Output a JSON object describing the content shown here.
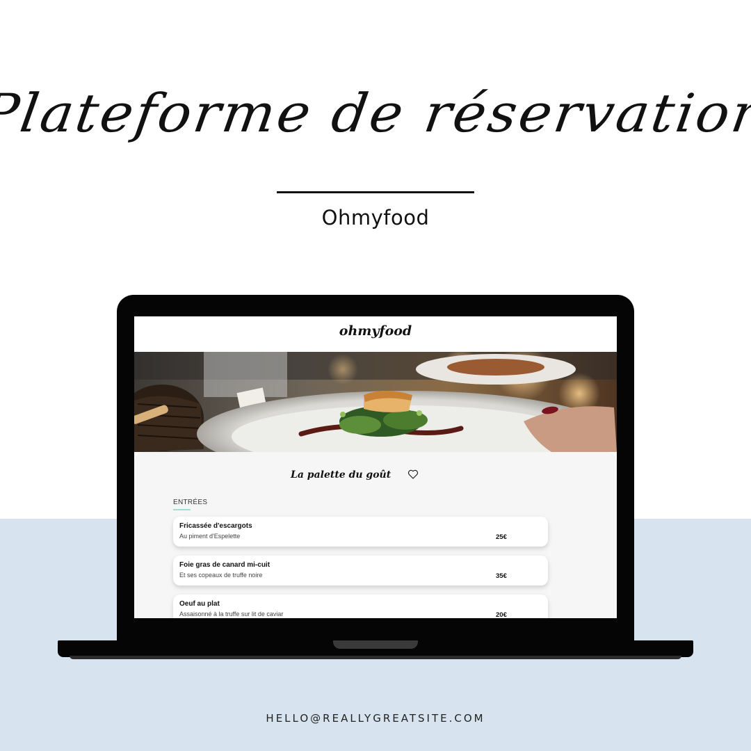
{
  "poster": {
    "title": "Plateforme de réservation",
    "subtitle": "Ohmyfood",
    "contact_email": "HELLO@REALLYGREATSITE.COM"
  },
  "website": {
    "logo": "ohmyfood",
    "hero_image": "restaurant-plated-dish-photo",
    "restaurant": {
      "name": "La palette du goût",
      "favorite_icon": "heart-icon"
    },
    "menu": {
      "section_label": "ENTRÉES",
      "items": [
        {
          "name": "Fricassée d'escargots",
          "description": "Au piment d'Espelette",
          "price": "25€"
        },
        {
          "name": "Foie gras de canard mi-cuit",
          "description": "Et ses copeaux de truffe noire",
          "price": "35€"
        },
        {
          "name": "Oeuf au plat",
          "description": "Assaisonné à la truffe sur lit de caviar",
          "price": "20€"
        }
      ]
    }
  },
  "colors": {
    "background_band": "#d7e4f0",
    "accent": "#99e2d0",
    "laptop": "#050505"
  }
}
